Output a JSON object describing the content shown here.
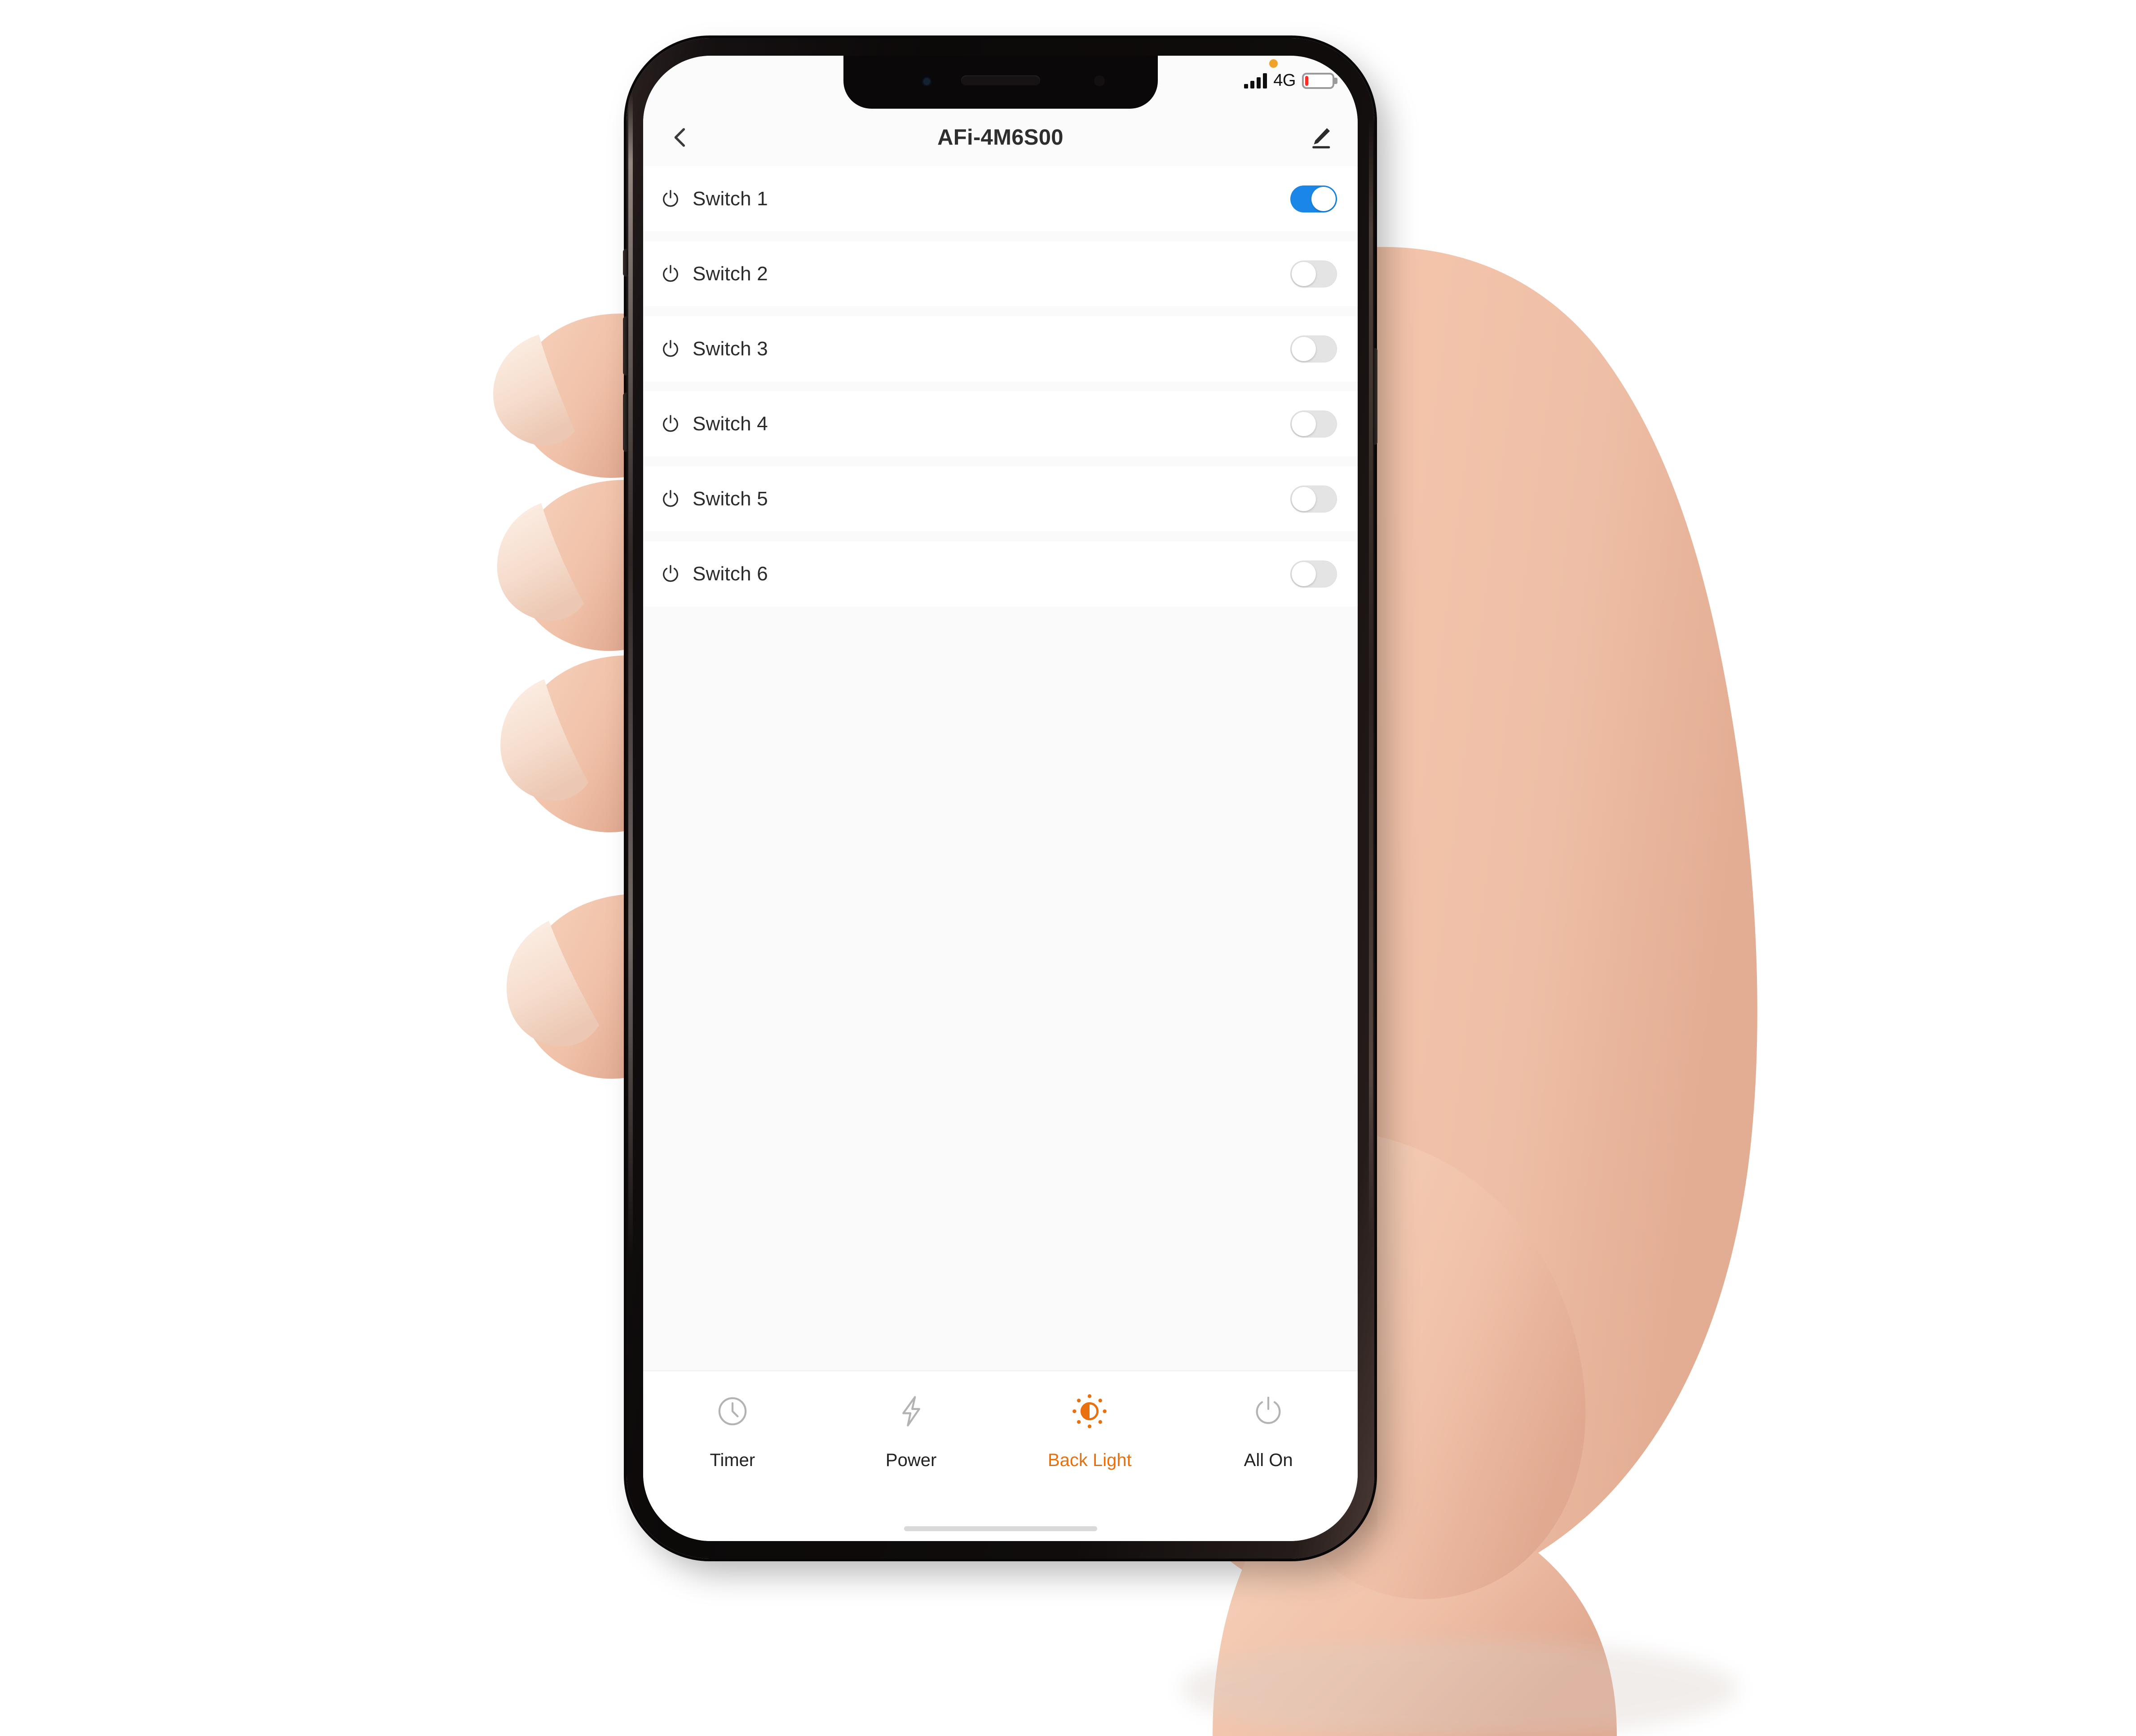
{
  "status_bar": {
    "notification_dot": "orange-dot",
    "signal_icon": "signal-bars-icon",
    "signal_bars": 4,
    "network": "4G",
    "battery_icon": "battery-low-icon",
    "battery_level_percent": 12,
    "battery_color": "#fa2d28"
  },
  "nav": {
    "back_icon": "chevron-left-icon",
    "title": "AFi-4M6S00",
    "edit_icon": "pencil-edit-icon"
  },
  "switches": [
    {
      "icon": "power-icon",
      "label": "Switch 1",
      "state": "on"
    },
    {
      "icon": "power-icon",
      "label": "Switch 2",
      "state": "off"
    },
    {
      "icon": "power-icon",
      "label": "Switch 3",
      "state": "off"
    },
    {
      "icon": "power-icon",
      "label": "Switch 4",
      "state": "off"
    },
    {
      "icon": "power-icon",
      "label": "Switch 5",
      "state": "off"
    },
    {
      "icon": "power-icon",
      "label": "Switch 6",
      "state": "off"
    }
  ],
  "tabbar": {
    "items": [
      {
        "icon": "clock-icon",
        "label": "Timer",
        "active": false
      },
      {
        "icon": "lightning-icon",
        "label": "Power",
        "active": false
      },
      {
        "icon": "brightness-icon",
        "label": "Back Light",
        "active": true
      },
      {
        "icon": "power-icon",
        "label": "All On",
        "active": false
      }
    ]
  },
  "colors": {
    "toggle_on": "#1a87e8",
    "toggle_off": "#e4e4e4",
    "accent": "#e8700f",
    "text": "#2b2b2b",
    "screen_bg": "#fafafa",
    "row_bg": "#ffffff",
    "icon_grey": "#b3b3b3"
  }
}
